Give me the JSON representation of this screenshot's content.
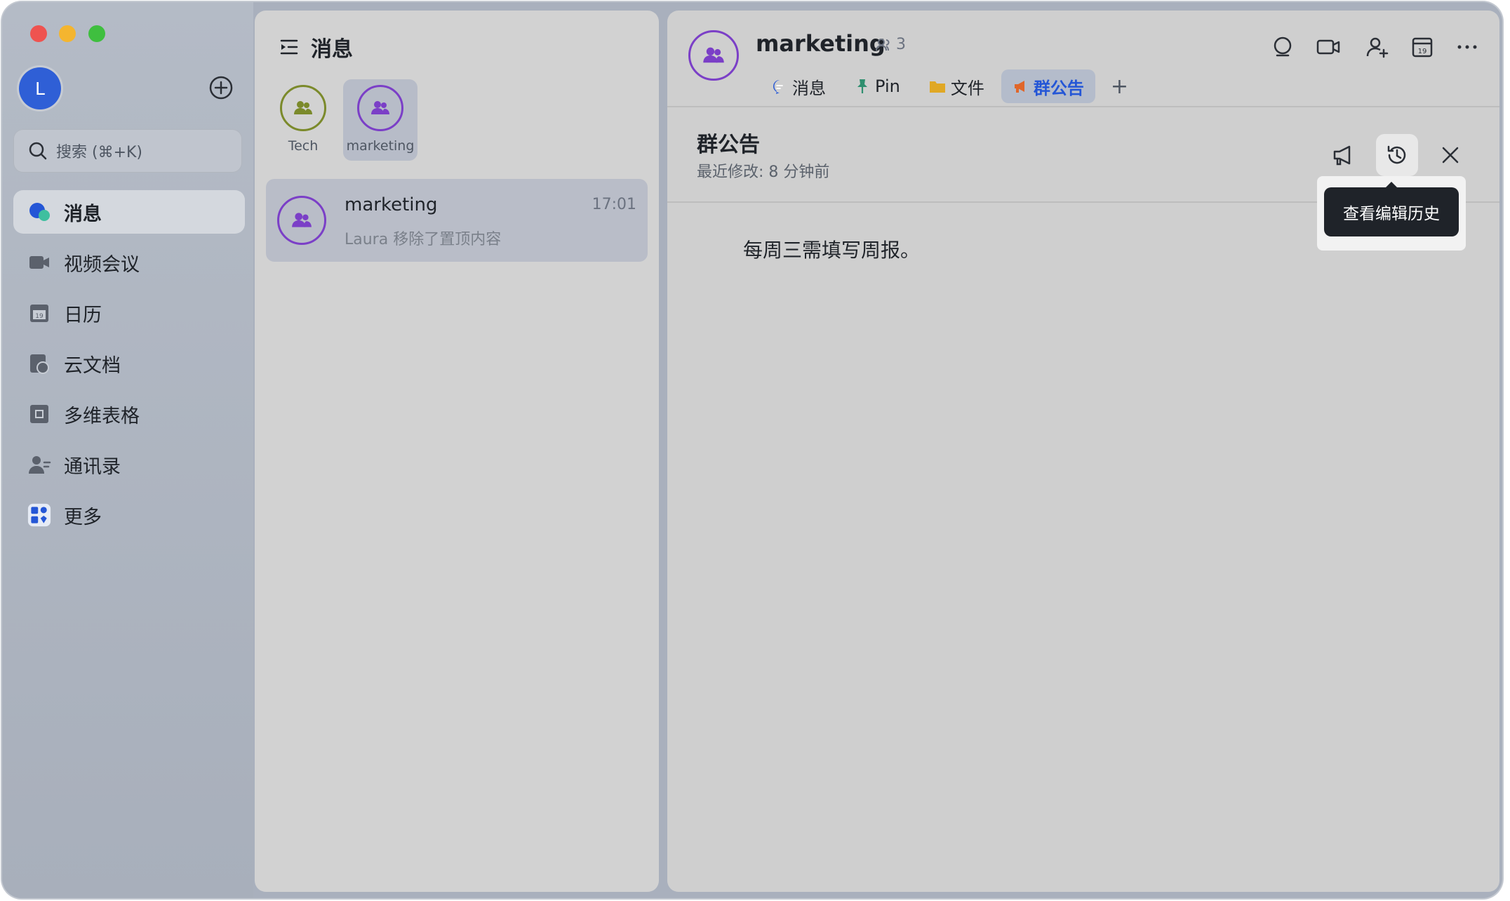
{
  "sidebar": {
    "avatar_initial": "L",
    "search_placeholder": "搜索 (⌘+K)",
    "items": [
      {
        "label": "消息",
        "icon": "chat-bubble-icon"
      },
      {
        "label": "视频会议",
        "icon": "video-camera-icon"
      },
      {
        "label": "日历",
        "icon": "calendar-icon"
      },
      {
        "label": "云文档",
        "icon": "cloud-doc-icon"
      },
      {
        "label": "多维表格",
        "icon": "base-table-icon"
      },
      {
        "label": "通讯录",
        "icon": "contacts-icon"
      },
      {
        "label": "更多",
        "icon": "more-apps-icon"
      }
    ]
  },
  "list": {
    "title": "消息",
    "pinned": [
      {
        "label": "Tech",
        "color": "#7b8a2b"
      },
      {
        "label": "marketing",
        "color": "#7b3fc7"
      }
    ],
    "conversations": [
      {
        "name": "marketing",
        "time": "17:01",
        "preview": "Laura 移除了置顶内容"
      }
    ]
  },
  "chat": {
    "name": "marketing",
    "member_count": "3",
    "tabs": [
      {
        "label": "消息",
        "icon": "chat-bubble-icon"
      },
      {
        "label": "Pin",
        "icon": "pin-icon"
      },
      {
        "label": "文件",
        "icon": "folder-icon"
      },
      {
        "label": "群公告",
        "icon": "megaphone-icon"
      }
    ],
    "tab_add": "+",
    "announcement": {
      "title": "群公告",
      "subtitle": "最近修改: 8 分钟前",
      "tooltip": "查看编辑历史",
      "body": "每周三需填写周报。"
    }
  },
  "colors": {
    "accent": "#2456d6",
    "group_purple": "#7b3fc7",
    "group_olive": "#7b8a2b"
  }
}
